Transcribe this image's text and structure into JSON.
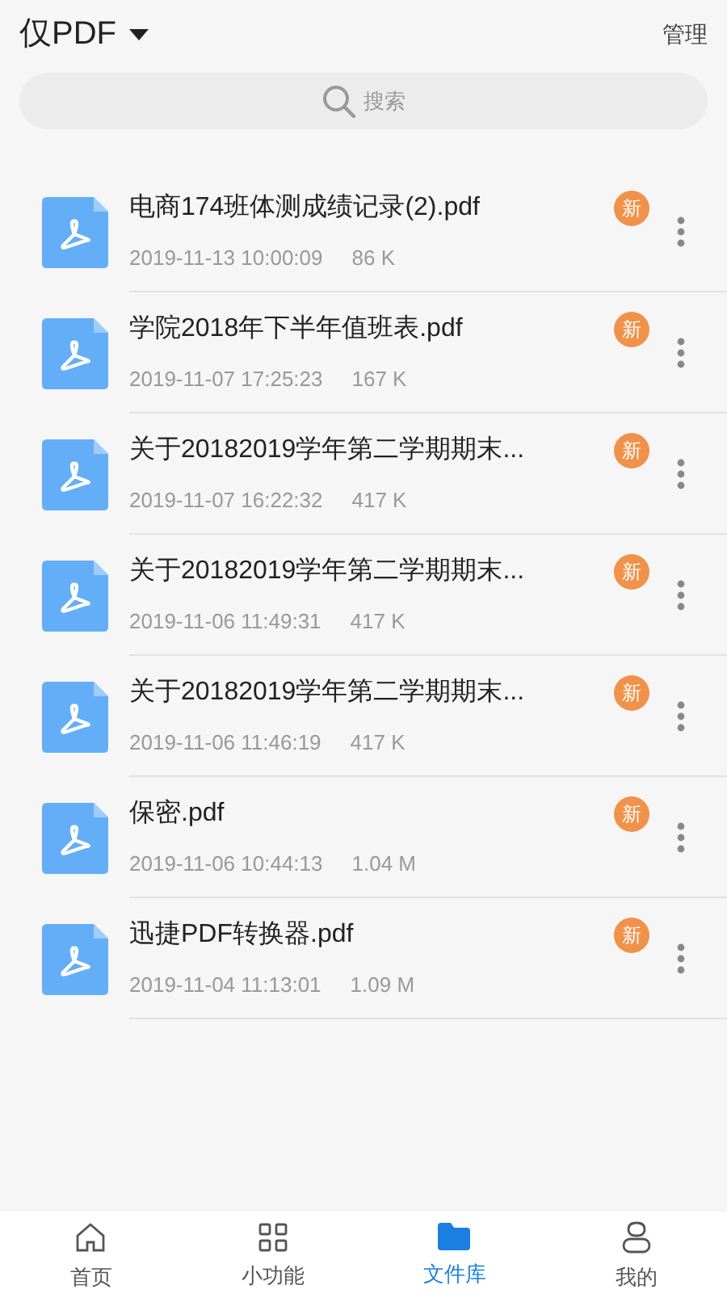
{
  "header": {
    "filter": "仅PDF",
    "manage": "管理"
  },
  "search": {
    "placeholder": "搜索"
  },
  "files": [
    {
      "name": "电商174班体测成绩记录(2).pdf",
      "date": "2019-11-13 10:00:09",
      "size": "86 K",
      "badge": "新"
    },
    {
      "name": "学院2018年下半年值班表.pdf",
      "date": "2019-11-07 17:25:23",
      "size": "167 K",
      "badge": "新"
    },
    {
      "name": "关于20182019学年第二学期期末...",
      "date": "2019-11-07 16:22:32",
      "size": "417 K",
      "badge": "新"
    },
    {
      "name": "关于20182019学年第二学期期末...",
      "date": "2019-11-06 11:49:31",
      "size": "417 K",
      "badge": "新"
    },
    {
      "name": "关于20182019学年第二学期期末...",
      "date": "2019-11-06 11:46:19",
      "size": "417 K",
      "badge": "新"
    },
    {
      "name": "保密.pdf",
      "date": "2019-11-06 10:44:13",
      "size": "1.04 M",
      "badge": "新"
    },
    {
      "name": "迅捷PDF转换器.pdf",
      "date": "2019-11-04 11:13:01",
      "size": "1.09 M",
      "badge": "新"
    }
  ],
  "nav": [
    {
      "label": "首页",
      "kind": "home",
      "selected": false
    },
    {
      "label": "小功能",
      "kind": "grid",
      "selected": false
    },
    {
      "label": "文件库",
      "kind": "folder",
      "selected": true
    },
    {
      "label": "我的",
      "kind": "user",
      "selected": false
    }
  ]
}
